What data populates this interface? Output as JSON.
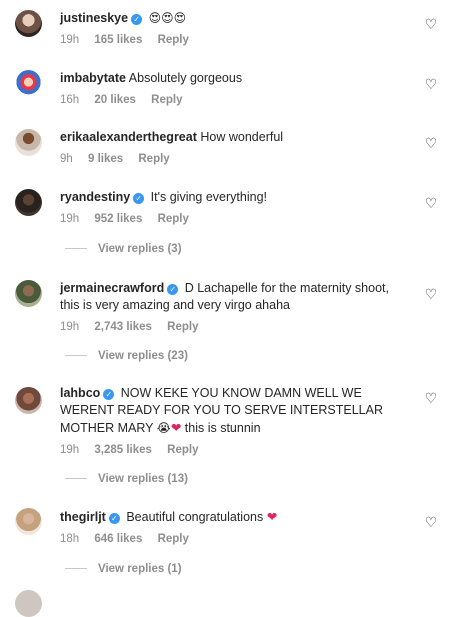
{
  "comments": [
    {
      "username": "justineskye",
      "verified": true,
      "text": "😍😍😍",
      "time": "19h",
      "likes": "165 likes",
      "reply": "Reply"
    },
    {
      "username": "imbabytate",
      "verified": false,
      "text": "Absolutely gorgeous",
      "time": "16h",
      "likes": "20 likes",
      "reply": "Reply"
    },
    {
      "username": "erikaalexanderthegreat",
      "verified": false,
      "text": "How wonderful",
      "time": "9h",
      "likes": "9 likes",
      "reply": "Reply"
    },
    {
      "username": "ryandestiny",
      "verified": true,
      "text": "It's giving everything!",
      "time": "19h",
      "likes": "952 likes",
      "reply": "Reply",
      "view_replies": "View replies (3)"
    },
    {
      "username": "jermainecrawford",
      "verified": true,
      "text": "D Lachapelle for the maternity shoot, this is very amazing and very virgo ahaha",
      "time": "19h",
      "likes": "2,743 likes",
      "reply": "Reply",
      "view_replies": "View replies (23)"
    },
    {
      "username": "lahbco",
      "verified": true,
      "text": "NOW KEKE YOU KNOW DAMN WELL WE WERENT READY FOR YOU TO SERVE INTERSTELLAR MOTHER MARY",
      "text_emoji": "😭",
      "text_heart": "❤",
      "text_tail": " this is stunnin",
      "time": "19h",
      "likes": "3,285 likes",
      "reply": "Reply",
      "view_replies": "View replies (13)"
    },
    {
      "username": "thegirljt",
      "verified": true,
      "text": "Beautiful congratulations",
      "text_heart": "❤",
      "time": "18h",
      "likes": "646 likes",
      "reply": "Reply",
      "view_replies": "View replies (1)"
    }
  ],
  "icons": {
    "like": "heart-outline-icon",
    "verified": "verified-badge-icon"
  },
  "colors": {
    "verified": "#3897f0",
    "meta": "#8e8e8e",
    "text": "#262626",
    "heart_emoji": "#e0245e"
  }
}
